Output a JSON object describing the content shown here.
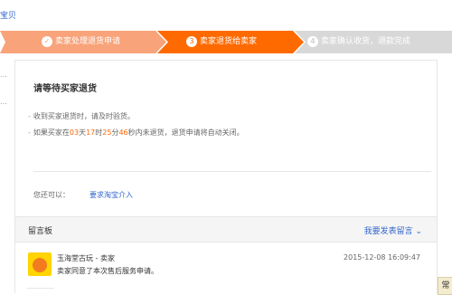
{
  "top_link": "宝贝",
  "steps": [
    {
      "icon": "✓",
      "label": "卖家处理退货申请",
      "state": "done"
    },
    {
      "icon": "3",
      "label": "卖家退货给卖家",
      "state": "active"
    },
    {
      "icon": "4",
      "label": "卖家确认收货，退款完成",
      "state": "todo"
    }
  ],
  "colors": {
    "done": "#f8a37a",
    "active": "#ff6a00",
    "todo": "#d8d8d8",
    "link": "#3366cc"
  },
  "main": {
    "title": "请等待买家退货",
    "note1": "收到买家退货时，请及时验货。",
    "note2": {
      "prefix": "如果买家在",
      "days": "03",
      "days_unit": "天",
      "hours": "17",
      "hours_unit": "时",
      "minutes": "25",
      "minutes_unit": "分",
      "seconds": "46",
      "suffix": "秒内未退货，退货申请将自动关闭。"
    },
    "also_label": "您还可以：",
    "intervene_link": "要求淘宝介入"
  },
  "board": {
    "title": "留言板",
    "action": "我要发表留言",
    "messages": [
      {
        "author": "玉海堂古玩 - 卖家",
        "time": "2015-12-08 16:09:47",
        "text": "卖家同意了本次售后服务申请。"
      }
    ]
  },
  "float_button": "常"
}
